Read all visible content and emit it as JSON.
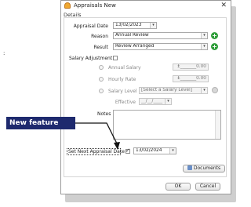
{
  "stray_text": ":",
  "dialog": {
    "title": "Appraisals New",
    "close_glyph": "✕",
    "section": "Details"
  },
  "form": {
    "appraisal_date_label": "Appraisal Date",
    "appraisal_date_value": "13/02/2023",
    "reason_label": "Reason",
    "reason_value": "Annual Review",
    "result_label": "Result",
    "result_value": "Review Arranged",
    "salary_adjustment_label": "Salary Adjustment",
    "annual_salary_label": "Annual Salary",
    "annual_salary_value": "£_______0.00",
    "hourly_rate_label": "Hourly Rate",
    "hourly_rate_value": "£_______0.00",
    "salary_level_label": "Salary Level",
    "salary_level_value": "[Select a Salary Level]",
    "effective_label": "Effective",
    "effective_value": "__/__/____",
    "notes_label": "Notes",
    "notes_value": "",
    "next_appraisal_label": "Set Next Appraisal Date",
    "next_appraisal_value": "13/02/2024"
  },
  "buttons": {
    "documents": "Documents",
    "ok": "OK",
    "cancel": "Cancel"
  },
  "callout": "New feature",
  "icons": {
    "title": "appraisal-icon",
    "add": "plus-icon",
    "gear": "gear-icon",
    "documents": "documents-icon"
  },
  "colors": {
    "accent_green": "#2f9e3a",
    "callout_bg": "#1e2a6e"
  }
}
